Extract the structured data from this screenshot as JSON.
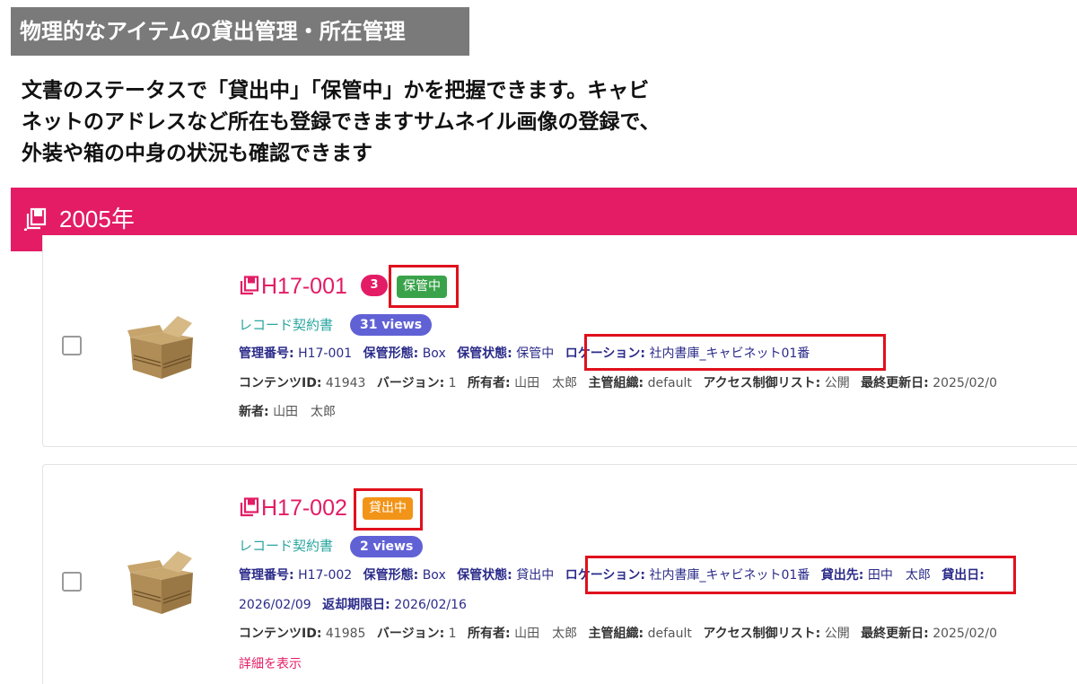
{
  "section": {
    "heading": "物理的なアイテムの貸出管理・所在管理",
    "description": [
      "文書のステータスで「貸出中」「保管中」かを把握できます。キャビ",
      "ネットのアドレスなど所在も登録できますサムネイル画像の登録で、",
      "外装や箱の中身の状況も確認できます"
    ]
  },
  "colors": {
    "accent": "#e31c65",
    "storage_badge": "#3aa34a",
    "lending_badge": "#f29418",
    "views_badge": "#6161d6",
    "highlight": "#e0101c"
  },
  "group": {
    "icon": "document-stack-icon",
    "year": "2005年"
  },
  "records": [
    {
      "title": "H17-001",
      "count": "3",
      "status": "保管中",
      "type": "レコード契約書",
      "views": "31 views",
      "line1": {
        "k1": "管理番号:",
        "v1": "H17-001",
        "k2": "保管形態:",
        "v2": "Box",
        "k3": "保管状態:",
        "v3": "保管中",
        "k4": "ロケーション:",
        "v4": "社内書庫_キャビネット01番"
      },
      "line2": {
        "k1": "コンテンツID:",
        "v1": "41943",
        "k2": "バージョン:",
        "v2": "1",
        "k3": "所有者:",
        "v3": "山田　太郎",
        "k4": "主管組織:",
        "v4": "default",
        "k5": "アクセス制御リスト:",
        "v5": "公開",
        "k6": "最終更新日:",
        "v6": "2025/02/0"
      },
      "line3": {
        "k1": "新者:",
        "v1": "山田　太郎"
      }
    },
    {
      "title": "H17-002",
      "status": "貸出中",
      "type": "レコード契約書",
      "views": "2 views",
      "line1": {
        "k1": "管理番号:",
        "v1": "H17-002",
        "k2": "保管形態:",
        "v2": "Box",
        "k3": "保管状態:",
        "v3": "貸出中",
        "k4": "ロケーション:",
        "v4": "社内書庫_キャビネット01番",
        "k5": "貸出先:",
        "v5": "田中　太郎",
        "k6": "貸出日:"
      },
      "line2": {
        "v0": "2026/02/09",
        "k1": "返却期限日:",
        "v1": "2026/02/16"
      },
      "line3": {
        "k1": "コンテンツID:",
        "v1": "41985",
        "k2": "バージョン:",
        "v2": "1",
        "k3": "所有者:",
        "v3": "山田　太郎",
        "k4": "主管組織:",
        "v4": "default",
        "k5": "アクセス制御リスト:",
        "v5": "公開",
        "k6": "最終更新日:",
        "v6": "2025/02/0"
      },
      "detail_link": "詳細を表示"
    }
  ]
}
